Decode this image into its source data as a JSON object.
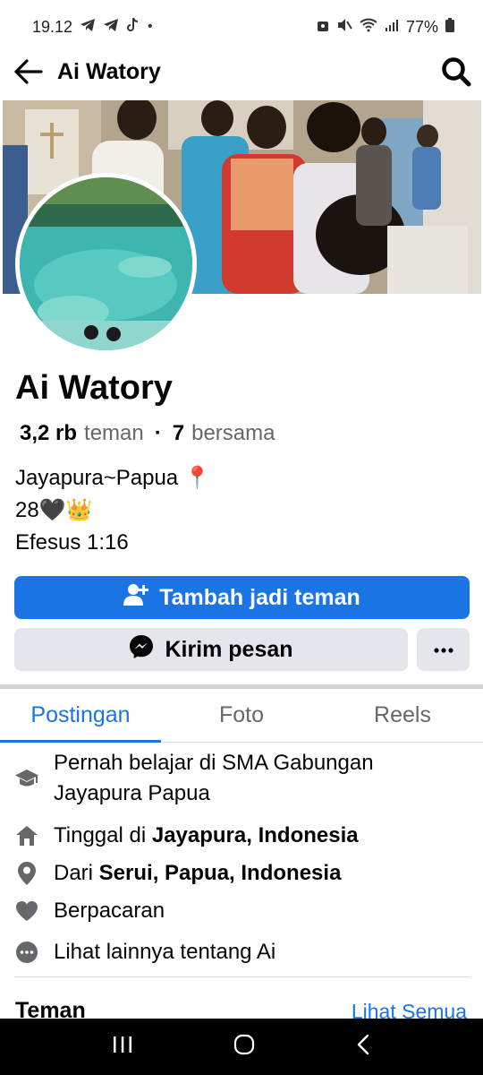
{
  "status_bar": {
    "time": "19.12",
    "battery": "77%"
  },
  "header": {
    "title": "Ai Watory"
  },
  "profile": {
    "name": "Ai Watory",
    "friends_count": "3,2 rb",
    "friends_label": "teman",
    "separator": "·",
    "mutual_count": "7",
    "mutual_label": "bersama",
    "bio_lines": [
      "Jayapura~Papua 📍",
      "28🖤👑",
      "Efesus 1:16"
    ]
  },
  "actions": {
    "add_friend_label": "Tambah jadi teman",
    "message_label": "Kirim pesan"
  },
  "tabs": [
    {
      "label": "Postingan",
      "active": true
    },
    {
      "label": "Foto",
      "active": false
    },
    {
      "label": "Reels",
      "active": false
    }
  ],
  "intro": {
    "education": "Pernah belajar di SMA Gabungan Jayapura Papua",
    "lives_prefix": "Tinggal di ",
    "lives_place": "Jayapura, Indonesia",
    "from_prefix": "Dari ",
    "from_place": "Serui, Papua, Indonesia",
    "relationship": "Berpacaran",
    "see_more": "Lihat lainnya tentang Ai"
  },
  "friends_section": {
    "title": "Teman",
    "see_all": "Lihat Semua"
  },
  "colors": {
    "accent": "#1b74e4",
    "secondary_button": "#e4e6eb",
    "muted_text": "#65676b"
  }
}
